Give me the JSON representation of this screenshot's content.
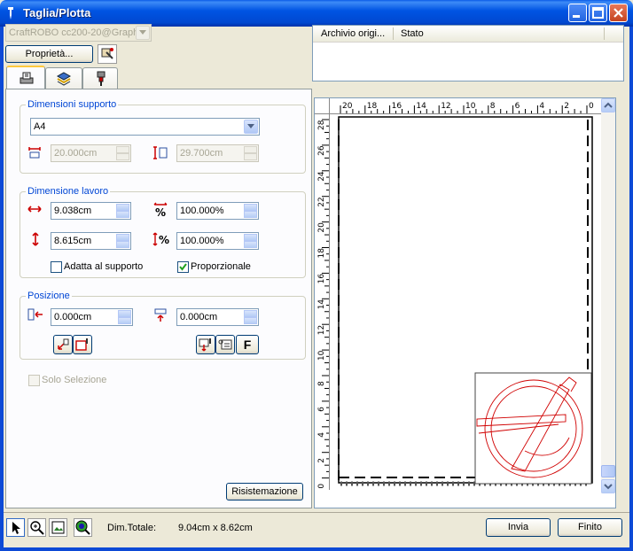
{
  "window": {
    "title": "Taglia/Plotta"
  },
  "device": {
    "selected": "CraftROBO cc200-20@Graph"
  },
  "buttons": {
    "properties": "Proprietà...",
    "reset": "Risistemazione",
    "send": "Invia",
    "finish": "Finito",
    "mirror_f": "F"
  },
  "jobs_list": {
    "columns": [
      "Archivio origi...",
      "Stato"
    ]
  },
  "tabs": [
    {
      "name": "media-settings-tab",
      "icon": "plotter-icon"
    },
    {
      "name": "layers-tab",
      "icon": "layers-icon"
    },
    {
      "name": "tool-settings-tab",
      "icon": "blade-icon"
    }
  ],
  "media": {
    "group_label": "Dimensioni supporto",
    "size": "A4",
    "width": "20.000cm",
    "height": "29.700cm"
  },
  "work": {
    "group_label": "Dimensione lavoro",
    "width": "9.038cm",
    "height": "8.615cm",
    "scale_x": "100.000%",
    "scale_y": "100.000%",
    "fit_media_label": "Adatta al supporto",
    "fit_media_checked": false,
    "proportional_label": "Proporzionale",
    "proportional_checked": true
  },
  "position": {
    "group_label": "Posizione",
    "x": "0.000cm",
    "y": "0.000cm"
  },
  "selection_only": {
    "label": "Solo Selezione",
    "checked": false
  },
  "ruler": {
    "h_ticks": [
      "20",
      "18",
      "16",
      "14",
      "12",
      "10",
      "8",
      "6",
      "4",
      "2",
      "0"
    ],
    "v_ticks": [
      "28",
      "26",
      "24",
      "22",
      "20",
      "18",
      "16",
      "14",
      "12",
      "10",
      "8",
      "6",
      "4",
      "2",
      "0"
    ]
  },
  "status": {
    "label": "Dim.Totale:",
    "value": "9.04cm x 8.62cm"
  },
  "colors": {
    "accent": "#0046d5",
    "drawing": "#d00000",
    "titlebar": "#0054e3"
  }
}
